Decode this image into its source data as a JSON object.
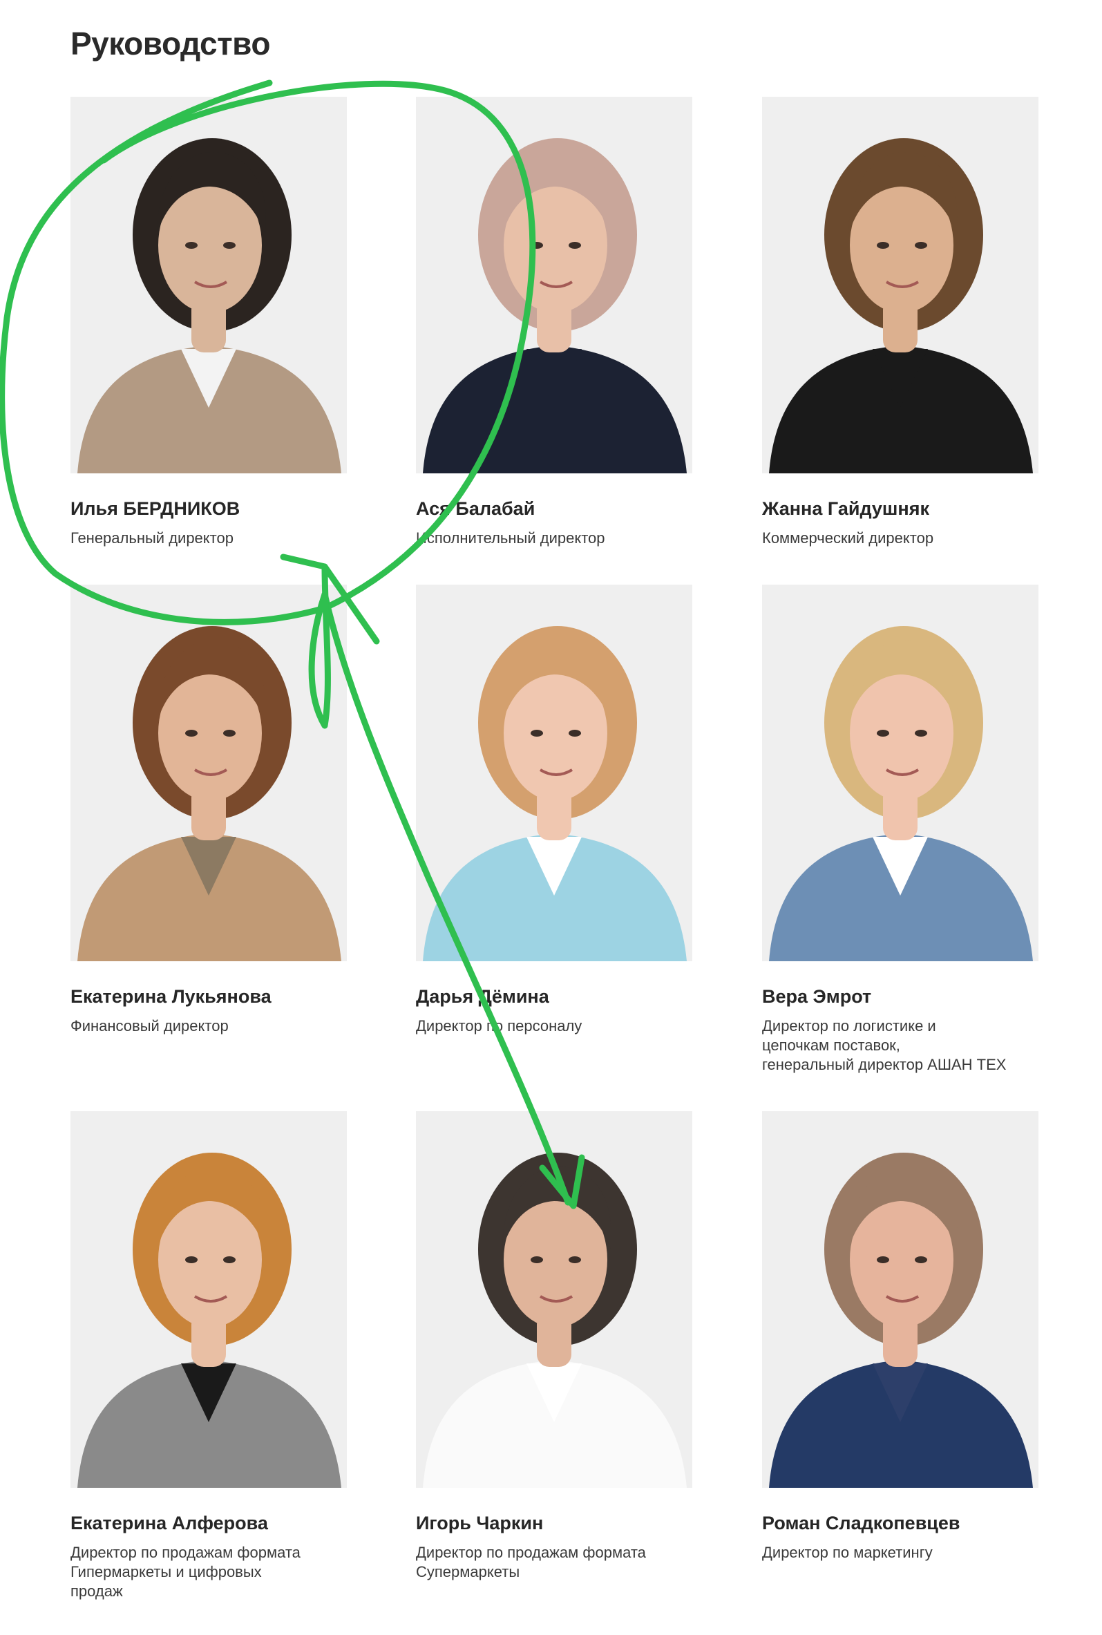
{
  "page_title": "Руководство",
  "accent_color": "#2fbf4f",
  "people": [
    {
      "name": "Илья БЕРДНИКОВ",
      "role": "Генеральный директор",
      "photo": "portrait-man-beige-suit",
      "skin": "#d9b59a",
      "hair": "#2b2420",
      "top": "#b39a83",
      "collar": "#f3f3f3"
    },
    {
      "name": "Ася Балабай",
      "role": "Исполнительный директор",
      "photo": "portrait-woman-blonde-dark-top",
      "skin": "#e8c0a8",
      "hair": "#c9a69a",
      "top": "#1c2233",
      "collar": "#1c2233"
    },
    {
      "name": "Жанна Гайдушняк",
      "role": "Коммерческий директор",
      "photo": "portrait-woman-brown-hair-black-top",
      "skin": "#dcb08f",
      "hair": "#6b4a2e",
      "top": "#1a1a1a",
      "collar": "#1a1a1a"
    },
    {
      "name": "Екатерина Лукьянова",
      "role": "Финансовый директор",
      "photo": "portrait-woman-auburn-tan-blazer",
      "skin": "#e2b597",
      "hair": "#7a4a2c",
      "top": "#c19a75",
      "collar": "#8c7a62"
    },
    {
      "name": "Дарья Дёмина",
      "role": "Директор по персоналу",
      "photo": "portrait-woman-blonde-light-blue-blazer",
      "skin": "#f0c7b0",
      "hair": "#d4a06e",
      "top": "#9dd3e3",
      "collar": "#ffffff"
    },
    {
      "name": "Вера Эмрот",
      "role": "Директор по логистике и\nцепочкам поставок,\nгенеральный директор АШАН ТЕХ",
      "photo": "portrait-woman-blonde-denim-jacket",
      "skin": "#f0c4ad",
      "hair": "#d9b77e",
      "top": "#6d8fb5",
      "collar": "#ffffff"
    },
    {
      "name": "Екатерина Алферова",
      "role": "Директор по продажам формата\nГипермаркеты и цифровых\nпродаж",
      "photo": "portrait-woman-curly-ginger-grey-blazer",
      "skin": "#e9bfa4",
      "hair": "#c9843a",
      "top": "#8a8a8a",
      "collar": "#1a1a1a"
    },
    {
      "name": "Игорь Чаркин",
      "role": "Директор по продажам формата\nСупермаркеты",
      "photo": "portrait-man-white-shirt",
      "skin": "#e0b49a",
      "hair": "#3d3530",
      "top": "#fafafa",
      "collar": "#ffffff"
    },
    {
      "name": "Роман Сладкопевцев",
      "role": "Директор по маркетингу",
      "photo": "portrait-man-glasses-blue-jacket",
      "skin": "#e6b49c",
      "hair": "#9a7a64",
      "top": "#243a66",
      "collar": "#2d3f6a"
    }
  ]
}
